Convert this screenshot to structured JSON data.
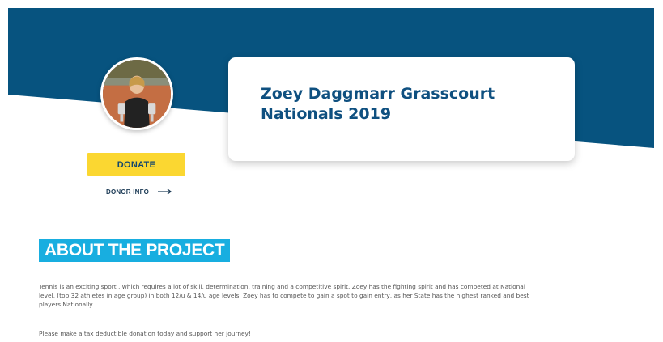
{
  "colors": {
    "hero": "#07537f",
    "accent_yellow": "#fbd731",
    "accent_cyan": "#18aee0",
    "title_blue": "#0f5080"
  },
  "profile": {
    "avatar_icon": "player-photo-icon"
  },
  "project": {
    "title": "Zoey Daggmarr Grasscourt Nationals 2019"
  },
  "actions": {
    "donate_label": "DONATE",
    "donor_info_label": "DONOR INFO",
    "donor_info_icon": "arrow-right-icon"
  },
  "about": {
    "heading": "ABOUT THE PROJECT",
    "paragraph": "Tennis is an exciting sport , which requires a lot of skill, determination, training and a competitive spirit. Zoey has the fighting spirit and has competed at National level, (top 32 athletes in age group) in both 12/u & 14/u age levels. Zoey has to compete to gain a spot to gain entry, as her State has the highest ranked and best players Nationally.",
    "call_to_action": "Please make a tax deductible donation today and support her journey!"
  }
}
